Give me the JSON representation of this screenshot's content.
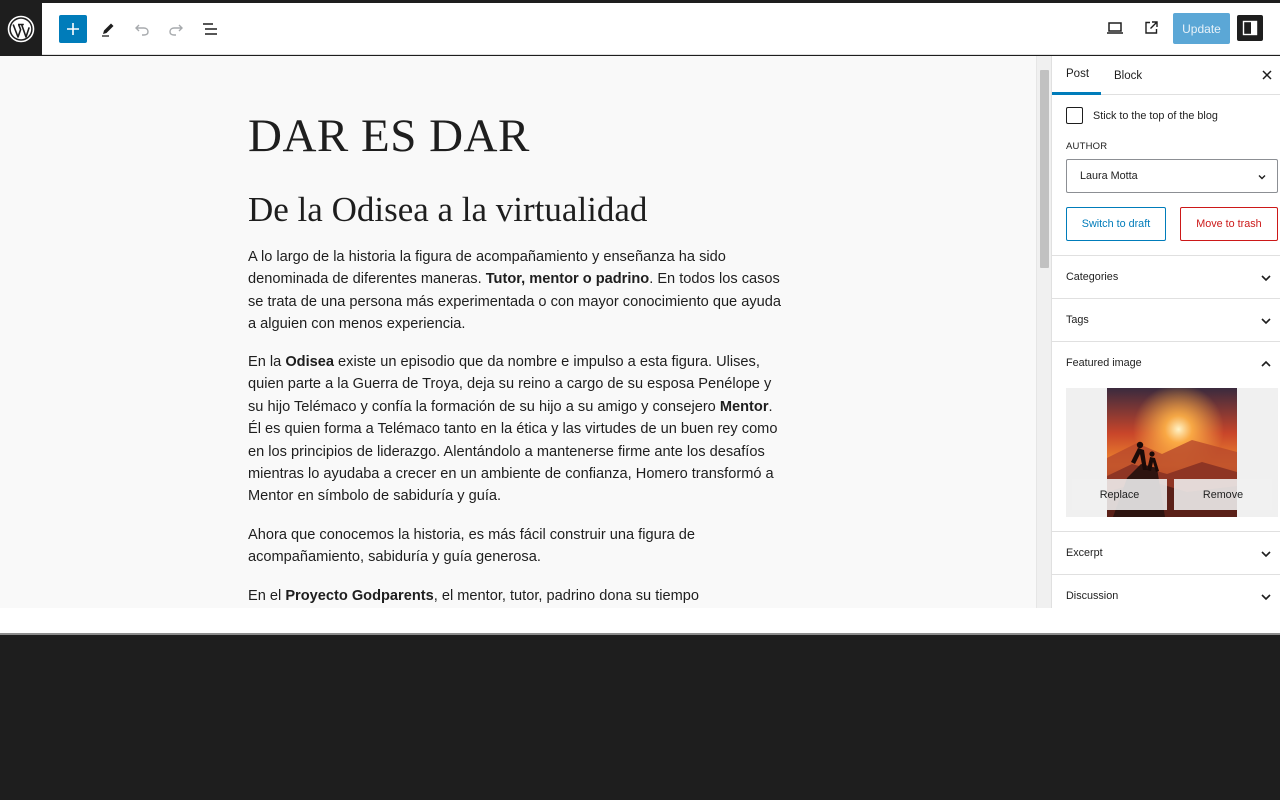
{
  "toolbar": {
    "logo_icon": "wordpress-logo-icon",
    "add_icon": "plus-icon",
    "tools_icon": "pencil-icon",
    "undo_icon": "undo-icon",
    "redo_icon": "redo-icon",
    "list_view_icon": "list-view-icon",
    "preview_icon": "desktop-icon",
    "view_post_icon": "external-link-icon",
    "update_label": "Update",
    "settings_icon": "sidebar-toggle-icon",
    "accent": "#007cba"
  },
  "post": {
    "title": "DAR ES DAR",
    "heading": "De la Odisea a la virtualidad",
    "p1": {
      "a": "A lo largo de la historia la figura de acompañamiento y enseñanza ha sido denominada de diferentes maneras. ",
      "b": "Tutor, mentor o padrino",
      "c": ". En todos los casos se trata de una persona más experimentada o con mayor conocimiento que ayuda a alguien con menos experiencia."
    },
    "p2": {
      "a": "En la ",
      "b": "Odisea",
      "c": " existe un episodio que da nombre e impulso a esta figura. Ulises, quien parte a la Guerra de Troya, deja su reino a cargo de su esposa Penélope y su hijo Telémaco y confía la formación de su hijo a su amigo y consejero ",
      "d": "Mentor",
      "e": ". Él es quien forma a Telémaco tanto en la ética y las virtudes de un buen rey como en los principios de liderazgo. Alentándolo a mantenerse firme ante los desafíos mientras lo ayudaba a crecer en un ambiente de confianza, Homero transformó a Mentor en símbolo de sabiduría y guía."
    },
    "p3": "Ahora que conocemos la historia, es más fácil construir una figura de acompañamiento, sabiduría y guía generosa.",
    "p4": {
      "a": "En el ",
      "b": "Proyecto Godparents",
      "c": ", el mentor, tutor, padrino dona su tiempo"
    }
  },
  "sidebar": {
    "tab_post": "Post",
    "tab_block": "Block",
    "close_icon": "close-icon",
    "stick_label": "Stick to the top of the blog",
    "stick_checked": false,
    "author_label": "AUTHOR",
    "author_value": "Laura Motta",
    "switch_draft": "Switch to draft",
    "move_trash": "Move to trash",
    "categories": "Categories",
    "tags": "Tags",
    "featured_image": "Featured image",
    "replace": "Replace",
    "remove": "Remove",
    "excerpt": "Excerpt",
    "discussion": "Discussion",
    "danger_color": "#cc1818"
  }
}
